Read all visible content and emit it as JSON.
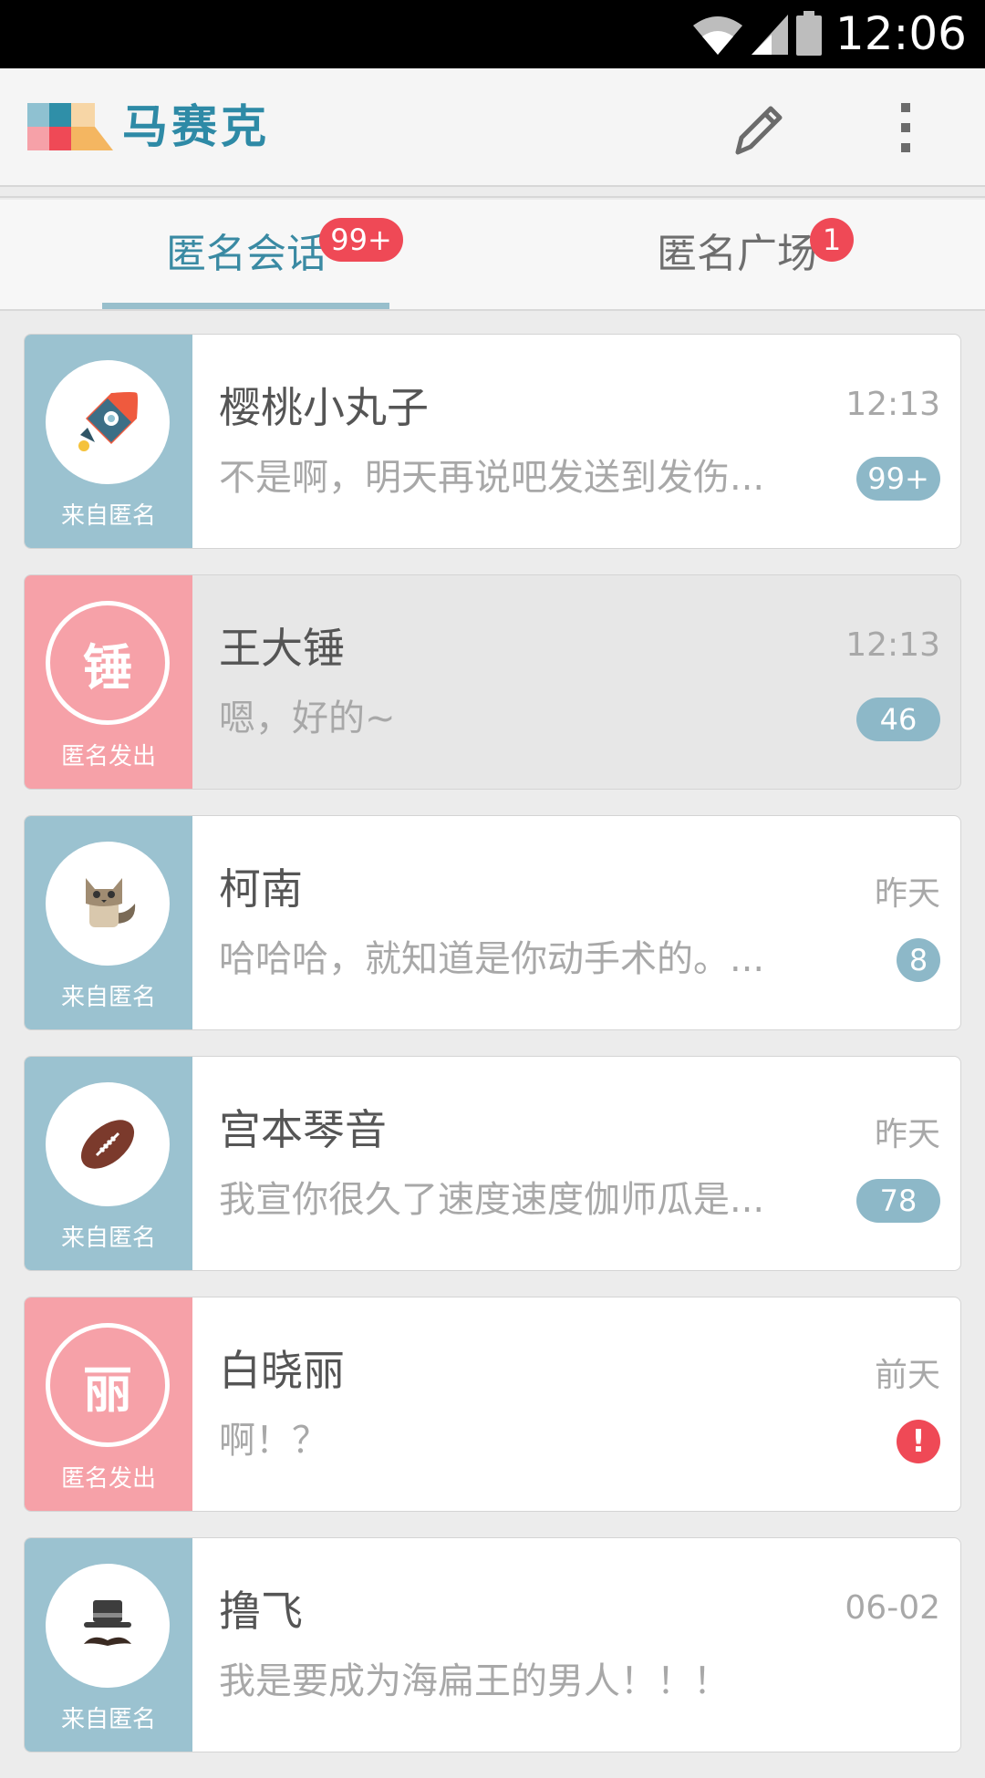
{
  "status_bar": {
    "time": "12:06"
  },
  "app_bar": {
    "title": "马赛克",
    "icons": [
      "logo-icon",
      "pencil-icon",
      "overflow-menu-icon"
    ]
  },
  "tabs": [
    {
      "label": "匿名会话",
      "badge": "99+",
      "active": true
    },
    {
      "label": "匿名广场",
      "badge": "1",
      "active": false
    }
  ],
  "conversations": [
    {
      "name": "樱桃小丸子",
      "message": "不是啊，明天再说吧发送到发伤...",
      "time": "12:13",
      "count": "99+",
      "source": "来自匿名",
      "avatar_icon": "rocket-icon",
      "avatar_char": "",
      "color": "blue"
    },
    {
      "name": "王大锤",
      "message": "嗯，好的~",
      "time": "12:13",
      "count": "46",
      "source": "匿名发出",
      "avatar_icon": "",
      "avatar_char": "锤",
      "color": "pink"
    },
    {
      "name": "柯南",
      "message": "哈哈哈，就知道是你动手术的。...",
      "time": "昨天",
      "count": "8",
      "source": "来自匿名",
      "avatar_icon": "cat-icon",
      "avatar_char": "",
      "color": "blue"
    },
    {
      "name": "宫本琴音",
      "message": "我宣你很久了速度速度伽师瓜是...",
      "time": "昨天",
      "count": "78",
      "source": "来自匿名",
      "avatar_icon": "football-icon",
      "avatar_char": "",
      "color": "blue"
    },
    {
      "name": "白晓丽",
      "message": "啊！？",
      "time": "前天",
      "alert": "!",
      "source": "匿名发出",
      "avatar_icon": "",
      "avatar_char": "丽",
      "color": "pink"
    },
    {
      "name": "撸飞",
      "message": "我是要成为海扁王的男人！！！",
      "time": "06-02",
      "count": "",
      "source": "来自匿名",
      "avatar_icon": "hat-mustache-icon",
      "avatar_char": "",
      "color": "blue"
    }
  ],
  "colors": {
    "accent": "#2e8aa6",
    "blue_panel": "#9bc2d0",
    "pink_panel": "#f6a1a8",
    "badge_red": "#ef4956",
    "count_badge": "#8db8c8"
  }
}
